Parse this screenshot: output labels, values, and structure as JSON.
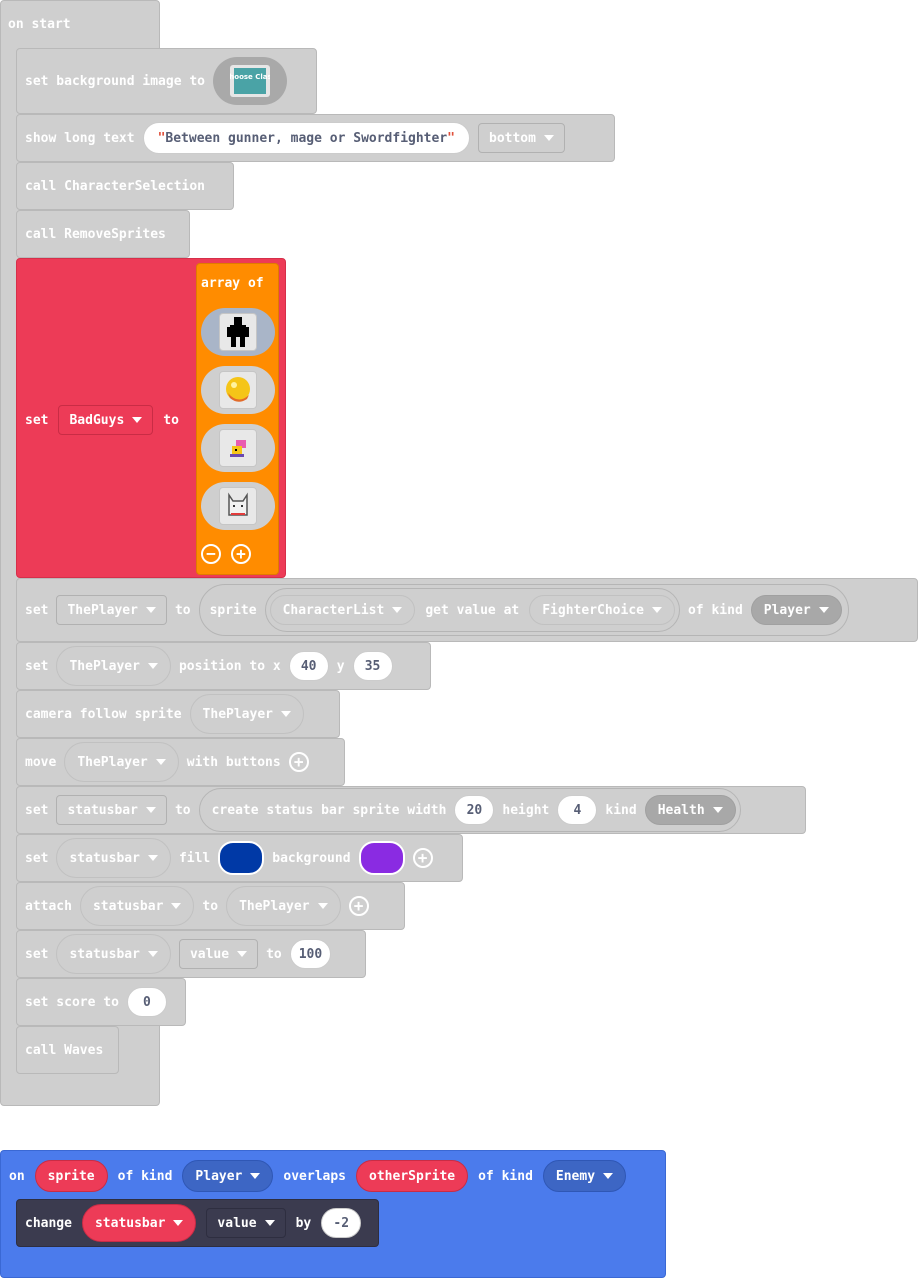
{
  "on_start": {
    "hat": "on start",
    "set_background": {
      "label": "set background image to",
      "image_caption": "Choose Class"
    },
    "show_long_text": {
      "label": "show long text",
      "text": "Between gunner, mage or Swordfighter",
      "position": "bottom"
    },
    "call_character_selection": "call CharacterSelection",
    "call_remove_sprites": "call RemoveSprites",
    "set_badguys": {
      "set": "set",
      "variable": "BadGuys",
      "to": "to",
      "array_label": "array of",
      "sprites": [
        "silhouette-sprite",
        "orb-sprite",
        "small-creature-sprite",
        "cat-sprite"
      ]
    },
    "set_theplayer": {
      "set": "set",
      "variable": "ThePlayer",
      "to": "to",
      "sprite": "sprite",
      "list": "CharacterList",
      "get_value_at": "get value at",
      "index": "FighterChoice",
      "of_kind": "of kind",
      "kind": "Player"
    },
    "set_position": {
      "set": "set",
      "sprite": "ThePlayer",
      "position_to_x": "position to x",
      "x": "40",
      "y_label": "y",
      "y": "35"
    },
    "camera_follow": {
      "label": "camera follow sprite",
      "sprite": "ThePlayer"
    },
    "move": {
      "label": "move",
      "sprite": "ThePlayer",
      "with_buttons": "with buttons"
    },
    "set_statusbar": {
      "set": "set",
      "variable": "statusbar",
      "to": "to",
      "create": "create status bar sprite width",
      "width": "20",
      "height_label": "height",
      "height": "4",
      "kind_label": "kind",
      "kind": "Health"
    },
    "set_colors": {
      "set": "set",
      "variable": "statusbar",
      "fill": "fill",
      "fill_color": "#0039a6",
      "background": "background",
      "background_color": "#8a2be2"
    },
    "attach": {
      "attach": "attach",
      "statusbar": "statusbar",
      "to": "to",
      "sprite": "ThePlayer"
    },
    "set_value": {
      "set": "set",
      "statusbar": "statusbar",
      "property": "value",
      "to": "to",
      "amount": "100"
    },
    "set_score": {
      "label": "set score to",
      "score": "0"
    },
    "call_waves": "call Waves"
  },
  "overlap": {
    "on": "on",
    "sprite": "sprite",
    "of_kind_1": "of kind",
    "kind1": "Player",
    "overlaps": "overlaps",
    "other": "otherSprite",
    "of_kind_2": "of kind",
    "kind2": "Enemy",
    "change": {
      "label": "change",
      "statusbar": "statusbar",
      "property": "value",
      "by": "by",
      "amount": "-2"
    }
  },
  "colors": {
    "gray_block": "#cfcfcf",
    "variables_red": "#ed3b57",
    "array_orange": "#ff8c00",
    "events_blue": "#4b7bec",
    "status_dark": "#3b3b4f"
  }
}
